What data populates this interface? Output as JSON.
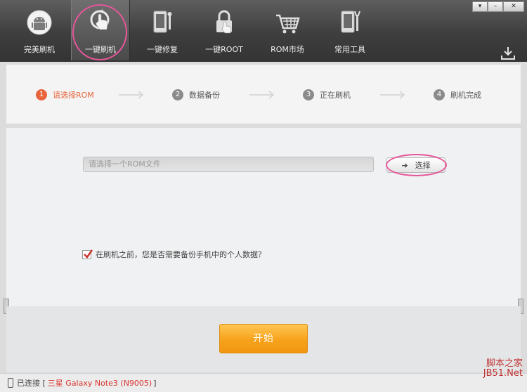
{
  "toolbar": {
    "items": [
      {
        "label": "完美刷机",
        "icon": "android-logo-icon"
      },
      {
        "label": "一键刷机",
        "icon": "flash-touch-icon",
        "active": true
      },
      {
        "label": "一键修复",
        "icon": "repair-phone-icon"
      },
      {
        "label": "一键ROOT",
        "icon": "root-lock-icon"
      },
      {
        "label": "ROM市场",
        "icon": "shopping-cart-icon"
      },
      {
        "label": "常用工具",
        "icon": "tools-icon"
      }
    ],
    "window_buttons": {
      "dropdown": "▾",
      "minimize": "–",
      "close": "✕"
    }
  },
  "steps": [
    {
      "num": "1",
      "label": "请选择ROM",
      "current": true
    },
    {
      "num": "2",
      "label": "数据备份"
    },
    {
      "num": "3",
      "label": "正在刷机"
    },
    {
      "num": "4",
      "label": "刷机完成"
    }
  ],
  "rom": {
    "placeholder": "请选择一个ROM文件",
    "choose_label": "选择"
  },
  "backup": {
    "checked": true,
    "label": "在刷机之前，您是否需要备份手机中的个人数据？"
  },
  "start_label": "开始",
  "status": {
    "connected_label": "已连接 [",
    "device": "三星 Galaxy Note3 (N9005)",
    "close_bracket": "]"
  },
  "watermark": {
    "line1": "脚本之家",
    "line2": "JB51.Net"
  },
  "colors": {
    "accent": "#e8643c",
    "start_button": "#f7a21b",
    "highlight_ring": "#e6569a"
  }
}
